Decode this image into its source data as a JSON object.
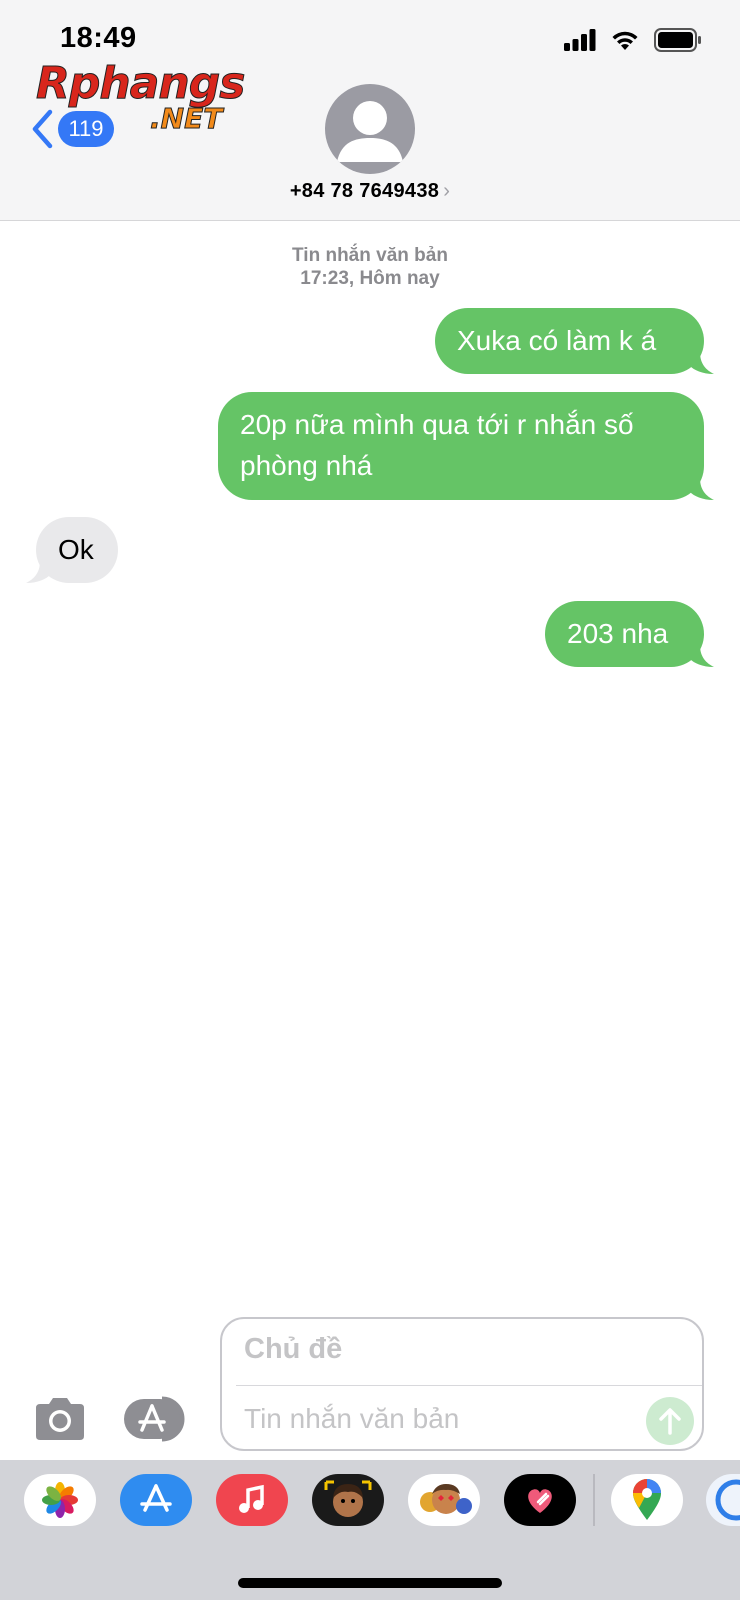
{
  "status_bar": {
    "time": "18:49",
    "icons": [
      "cellular-signal-icon",
      "wifi-icon",
      "battery-icon"
    ]
  },
  "watermark": {
    "line1": "Rphangs",
    "line2": ".NET"
  },
  "header": {
    "back_badge": "119",
    "contact_number": "+84 78 7649438",
    "chevron": "›"
  },
  "conversation": {
    "meta_label": "Tin nhắn văn bản",
    "meta_time": "17:23, Hôm nay",
    "messages": [
      {
        "direction": "sent",
        "text": "Xuka có làm k á"
      },
      {
        "direction": "sent",
        "text": "20p nữa mình qua tới r nhắn số phòng nhá"
      },
      {
        "direction": "received",
        "text": "Ok"
      },
      {
        "direction": "sent",
        "text": "203 nha"
      }
    ]
  },
  "composer": {
    "subject_placeholder": "Chủ đề",
    "message_placeholder": "Tin nhắn văn bản"
  },
  "app_drawer": {
    "apps": [
      "photos-app-icon",
      "app-store-icon",
      "music-app-icon",
      "memoji-camera-icon",
      "memoji-stickers-icon",
      "digital-touch-icon",
      "google-maps-icon",
      "more-app-icon"
    ]
  },
  "colors": {
    "sent_bubble": "#65c466",
    "received_bubble": "#e9e9eb",
    "accent_blue": "#3478f6"
  }
}
